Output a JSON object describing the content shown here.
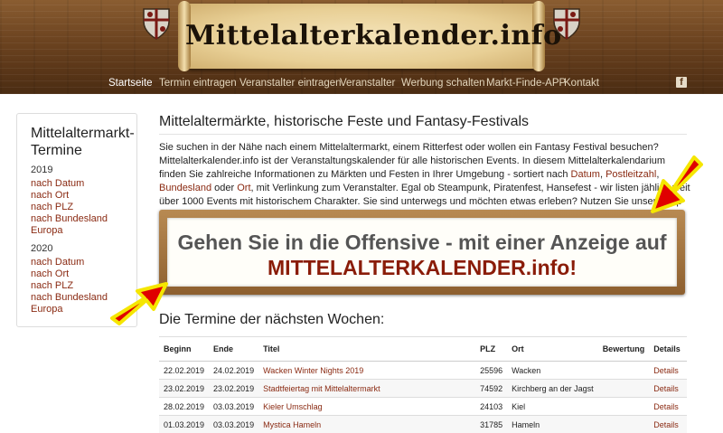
{
  "header": {
    "site_title": "Mittelalterkalender.info",
    "nav": [
      {
        "label": "Startseite",
        "active": true
      },
      {
        "label": "Termin eintragen"
      },
      {
        "label": "Veranstalter eintragen"
      },
      {
        "label": "Veranstalter"
      },
      {
        "label": "Werbung schalten"
      },
      {
        "label": "Markt-Finde-APP"
      },
      {
        "label": "Kontakt"
      }
    ],
    "facebook_icon": "facebook-icon",
    "colors": {
      "wood": "#6e4521",
      "parchment": "#f4e3b8"
    }
  },
  "sidebar": {
    "title": "Mittelaltermarkt-Termine",
    "groups": [
      {
        "year": "2019",
        "links": [
          "nach Datum",
          "nach Ort",
          "nach PLZ",
          "nach Bundesland",
          "Europa"
        ]
      },
      {
        "year": "2020",
        "links": [
          "nach Datum",
          "nach Ort",
          "nach PLZ",
          "nach Bundesland",
          "Europa"
        ]
      }
    ]
  },
  "main": {
    "title": "Mittelaltermärkte, historische Feste und Fantasy-Festivals",
    "intro": {
      "p1": "Sie suchen in der Nähe nach einem Mittelaltermarkt, einem Ritterfest oder wollen ein Fantasy Festival besuchen? Mittelalterkalender.info ist der Veranstaltungskalender für alle historischen Events. In diesem Mittelalterkalendarium finden Sie zahlreiche Informationen zu Märkten und Festen in Ihrer Umgebung - sortiert nach ",
      "link_datum": "Datum",
      "sep1": ", ",
      "link_plz": "Postleitzahl",
      "sep2": ", ",
      "link_bundesland": "Bundesland",
      "sep3": " oder ",
      "link_ort": "Ort",
      "p2": ", mit Verlinkung zum Veranstalter. Egal ob Steampunk, Piratenfest, Hansefest - wir listen jählich weit über 1000 Events mit historischem Charakter. Sie sind unterwegs und möchten etwas erleben? Nutzen Sie unsere App mit Umkreissuche von ihrem Standort."
    },
    "ad": {
      "line1": "Gehen Sie in die Offensive - mit einer Anzeige auf",
      "line2": "MITTELALTERKALENDER.info!",
      "arrow_color": "#e00000",
      "arrow_outline": "#f5e600"
    },
    "events_heading": "Die Termine der nächsten Wochen:",
    "table": {
      "headers": [
        "Beginn",
        "Ende",
        "Titel",
        "PLZ",
        "Ort",
        "Bewertung",
        "Details"
      ],
      "rows": [
        [
          "22.02.2019",
          "24.02.2019",
          "Wacken Winter Nights 2019",
          "25596",
          "Wacken",
          "",
          "Details"
        ],
        [
          "23.02.2019",
          "23.02.2019",
          "Stadtfeiertag mit Mittelaltermarkt",
          "74592",
          "Kirchberg an der Jagst",
          "",
          "Details"
        ],
        [
          "28.02.2019",
          "03.03.2019",
          "Kieler Umschlag",
          "24103",
          "Kiel",
          "",
          "Details"
        ],
        [
          "01.03.2019",
          "03.03.2019",
          "Mystica Hameln",
          "31785",
          "Hameln",
          "",
          "Details"
        ]
      ]
    }
  }
}
